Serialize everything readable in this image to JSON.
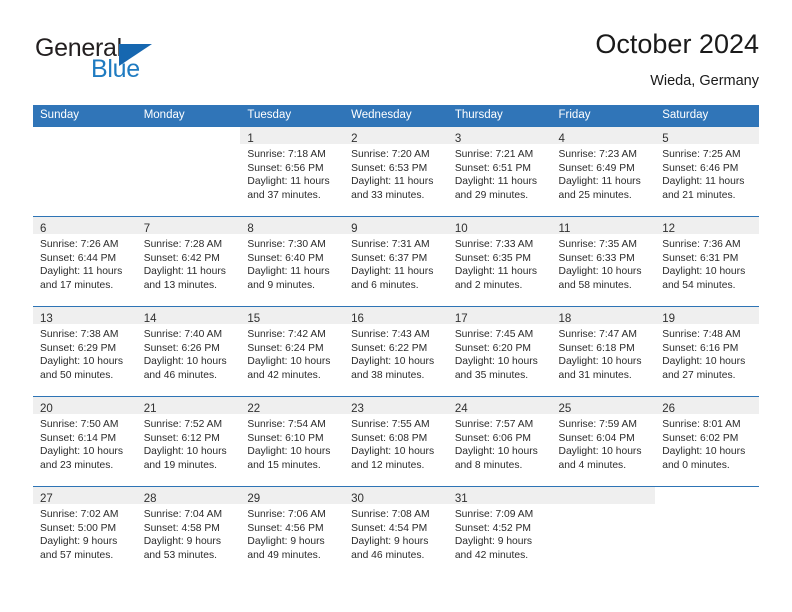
{
  "brand": {
    "name_top": "General",
    "name_bottom": "Blue",
    "triangle_color": "#1667b0",
    "blue_color": "#1f7bc1"
  },
  "header": {
    "title": "October 2024",
    "subtitle": "Wieda, Germany"
  },
  "theme": {
    "header_blue": "#3075b8",
    "divider_blue": "#2e74b5",
    "daynum_band": "#efefef"
  },
  "weekdays": [
    "Sunday",
    "Monday",
    "Tuesday",
    "Wednesday",
    "Thursday",
    "Friday",
    "Saturday"
  ],
  "labels": {
    "sunrise_prefix": "Sunrise:",
    "sunset_prefix": "Sunset:",
    "daylight_prefix": "Daylight:"
  },
  "weeks": [
    [
      {
        "day": "",
        "blank": true
      },
      {
        "day": "",
        "blank": true
      },
      {
        "day": "1",
        "sunrise": "Sunrise: 7:18 AM",
        "sunset": "Sunset: 6:56 PM",
        "daylight_l1": "Daylight: 11 hours",
        "daylight_l2": "and 37 minutes."
      },
      {
        "day": "2",
        "sunrise": "Sunrise: 7:20 AM",
        "sunset": "Sunset: 6:53 PM",
        "daylight_l1": "Daylight: 11 hours",
        "daylight_l2": "and 33 minutes."
      },
      {
        "day": "3",
        "sunrise": "Sunrise: 7:21 AM",
        "sunset": "Sunset: 6:51 PM",
        "daylight_l1": "Daylight: 11 hours",
        "daylight_l2": "and 29 minutes."
      },
      {
        "day": "4",
        "sunrise": "Sunrise: 7:23 AM",
        "sunset": "Sunset: 6:49 PM",
        "daylight_l1": "Daylight: 11 hours",
        "daylight_l2": "and 25 minutes."
      },
      {
        "day": "5",
        "sunrise": "Sunrise: 7:25 AM",
        "sunset": "Sunset: 6:46 PM",
        "daylight_l1": "Daylight: 11 hours",
        "daylight_l2": "and 21 minutes."
      }
    ],
    [
      {
        "day": "6",
        "sunrise": "Sunrise: 7:26 AM",
        "sunset": "Sunset: 6:44 PM",
        "daylight_l1": "Daylight: 11 hours",
        "daylight_l2": "and 17 minutes."
      },
      {
        "day": "7",
        "sunrise": "Sunrise: 7:28 AM",
        "sunset": "Sunset: 6:42 PM",
        "daylight_l1": "Daylight: 11 hours",
        "daylight_l2": "and 13 minutes."
      },
      {
        "day": "8",
        "sunrise": "Sunrise: 7:30 AM",
        "sunset": "Sunset: 6:40 PM",
        "daylight_l1": "Daylight: 11 hours",
        "daylight_l2": "and 9 minutes."
      },
      {
        "day": "9",
        "sunrise": "Sunrise: 7:31 AM",
        "sunset": "Sunset: 6:37 PM",
        "daylight_l1": "Daylight: 11 hours",
        "daylight_l2": "and 6 minutes."
      },
      {
        "day": "10",
        "sunrise": "Sunrise: 7:33 AM",
        "sunset": "Sunset: 6:35 PM",
        "daylight_l1": "Daylight: 11 hours",
        "daylight_l2": "and 2 minutes."
      },
      {
        "day": "11",
        "sunrise": "Sunrise: 7:35 AM",
        "sunset": "Sunset: 6:33 PM",
        "daylight_l1": "Daylight: 10 hours",
        "daylight_l2": "and 58 minutes."
      },
      {
        "day": "12",
        "sunrise": "Sunrise: 7:36 AM",
        "sunset": "Sunset: 6:31 PM",
        "daylight_l1": "Daylight: 10 hours",
        "daylight_l2": "and 54 minutes."
      }
    ],
    [
      {
        "day": "13",
        "sunrise": "Sunrise: 7:38 AM",
        "sunset": "Sunset: 6:29 PM",
        "daylight_l1": "Daylight: 10 hours",
        "daylight_l2": "and 50 minutes."
      },
      {
        "day": "14",
        "sunrise": "Sunrise: 7:40 AM",
        "sunset": "Sunset: 6:26 PM",
        "daylight_l1": "Daylight: 10 hours",
        "daylight_l2": "and 46 minutes."
      },
      {
        "day": "15",
        "sunrise": "Sunrise: 7:42 AM",
        "sunset": "Sunset: 6:24 PM",
        "daylight_l1": "Daylight: 10 hours",
        "daylight_l2": "and 42 minutes."
      },
      {
        "day": "16",
        "sunrise": "Sunrise: 7:43 AM",
        "sunset": "Sunset: 6:22 PM",
        "daylight_l1": "Daylight: 10 hours",
        "daylight_l2": "and 38 minutes."
      },
      {
        "day": "17",
        "sunrise": "Sunrise: 7:45 AM",
        "sunset": "Sunset: 6:20 PM",
        "daylight_l1": "Daylight: 10 hours",
        "daylight_l2": "and 35 minutes."
      },
      {
        "day": "18",
        "sunrise": "Sunrise: 7:47 AM",
        "sunset": "Sunset: 6:18 PM",
        "daylight_l1": "Daylight: 10 hours",
        "daylight_l2": "and 31 minutes."
      },
      {
        "day": "19",
        "sunrise": "Sunrise: 7:48 AM",
        "sunset": "Sunset: 6:16 PM",
        "daylight_l1": "Daylight: 10 hours",
        "daylight_l2": "and 27 minutes."
      }
    ],
    [
      {
        "day": "20",
        "sunrise": "Sunrise: 7:50 AM",
        "sunset": "Sunset: 6:14 PM",
        "daylight_l1": "Daylight: 10 hours",
        "daylight_l2": "and 23 minutes."
      },
      {
        "day": "21",
        "sunrise": "Sunrise: 7:52 AM",
        "sunset": "Sunset: 6:12 PM",
        "daylight_l1": "Daylight: 10 hours",
        "daylight_l2": "and 19 minutes."
      },
      {
        "day": "22",
        "sunrise": "Sunrise: 7:54 AM",
        "sunset": "Sunset: 6:10 PM",
        "daylight_l1": "Daylight: 10 hours",
        "daylight_l2": "and 15 minutes."
      },
      {
        "day": "23",
        "sunrise": "Sunrise: 7:55 AM",
        "sunset": "Sunset: 6:08 PM",
        "daylight_l1": "Daylight: 10 hours",
        "daylight_l2": "and 12 minutes."
      },
      {
        "day": "24",
        "sunrise": "Sunrise: 7:57 AM",
        "sunset": "Sunset: 6:06 PM",
        "daylight_l1": "Daylight: 10 hours",
        "daylight_l2": "and 8 minutes."
      },
      {
        "day": "25",
        "sunrise": "Sunrise: 7:59 AM",
        "sunset": "Sunset: 6:04 PM",
        "daylight_l1": "Daylight: 10 hours",
        "daylight_l2": "and 4 minutes."
      },
      {
        "day": "26",
        "sunrise": "Sunrise: 8:01 AM",
        "sunset": "Sunset: 6:02 PM",
        "daylight_l1": "Daylight: 10 hours",
        "daylight_l2": "and 0 minutes."
      }
    ],
    [
      {
        "day": "27",
        "sunrise": "Sunrise: 7:02 AM",
        "sunset": "Sunset: 5:00 PM",
        "daylight_l1": "Daylight: 9 hours",
        "daylight_l2": "and 57 minutes."
      },
      {
        "day": "28",
        "sunrise": "Sunrise: 7:04 AM",
        "sunset": "Sunset: 4:58 PM",
        "daylight_l1": "Daylight: 9 hours",
        "daylight_l2": "and 53 minutes."
      },
      {
        "day": "29",
        "sunrise": "Sunrise: 7:06 AM",
        "sunset": "Sunset: 4:56 PM",
        "daylight_l1": "Daylight: 9 hours",
        "daylight_l2": "and 49 minutes."
      },
      {
        "day": "30",
        "sunrise": "Sunrise: 7:08 AM",
        "sunset": "Sunset: 4:54 PM",
        "daylight_l1": "Daylight: 9 hours",
        "daylight_l2": "and 46 minutes."
      },
      {
        "day": "31",
        "sunrise": "Sunrise: 7:09 AM",
        "sunset": "Sunset: 4:52 PM",
        "daylight_l1": "Daylight: 9 hours",
        "daylight_l2": "and 42 minutes."
      },
      {
        "day": "",
        "empty": true
      },
      {
        "day": "",
        "blank": true
      }
    ]
  ]
}
